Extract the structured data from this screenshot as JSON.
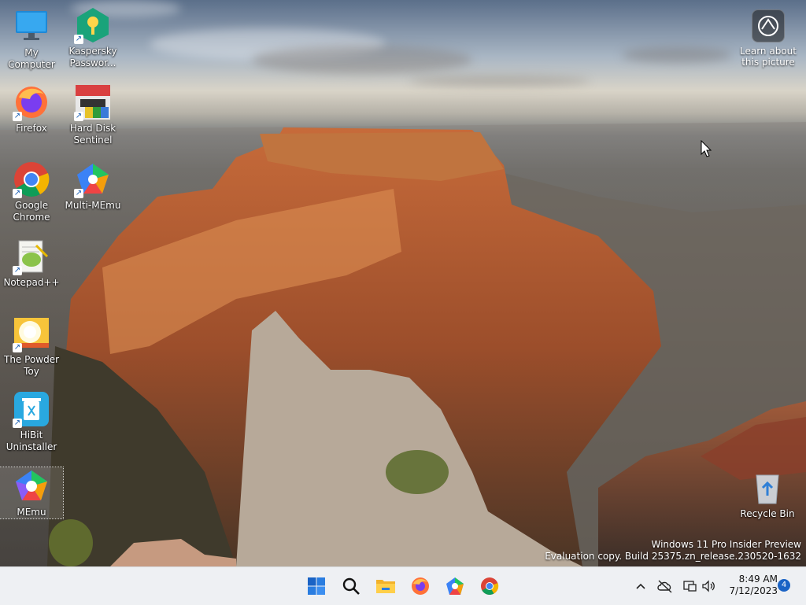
{
  "desktop": {
    "icons": [
      {
        "label": "My Computer",
        "icon": "monitor-icon"
      },
      {
        "label": "Kaspersky Passwor...",
        "icon": "kaspersky-password-icon"
      },
      {
        "label": "Firefox",
        "icon": "firefox-icon"
      },
      {
        "label": "Hard Disk Sentinel",
        "icon": "hard-disk-sentinel-icon"
      },
      {
        "label": "Google Chrome",
        "icon": "chrome-icon"
      },
      {
        "label": "Multi-MEmu",
        "icon": "multi-memu-icon"
      },
      {
        "label": "Notepad++",
        "icon": "notepadpp-icon"
      },
      {
        "label": "The Powder Toy",
        "icon": "powder-toy-icon"
      },
      {
        "label": "HiBit Uninstaller",
        "icon": "hibit-uninstaller-icon"
      },
      {
        "label": "MEmu",
        "icon": "memu-icon"
      },
      {
        "label": "Recycle Bin",
        "icon": "recycle-bin-icon"
      }
    ],
    "learn_picture": {
      "line1": "Learn about",
      "line2": "this picture"
    },
    "watermark": {
      "line1": "Windows 11 Pro Insider Preview",
      "line2": "Evaluation copy. Build 25375.zn_release.230520-1632"
    }
  },
  "taskbar": {
    "apps": [
      "start-icon",
      "search-icon",
      "file-explorer-icon",
      "firefox-icon",
      "memu-icon",
      "chrome-icon"
    ],
    "tray": {
      "time": "8:49 AM",
      "date": "7/12/2023",
      "notification_count": "4"
    }
  },
  "colors": {
    "taskbar_bg": "#eef0f3",
    "accent": "#1a63c5"
  }
}
